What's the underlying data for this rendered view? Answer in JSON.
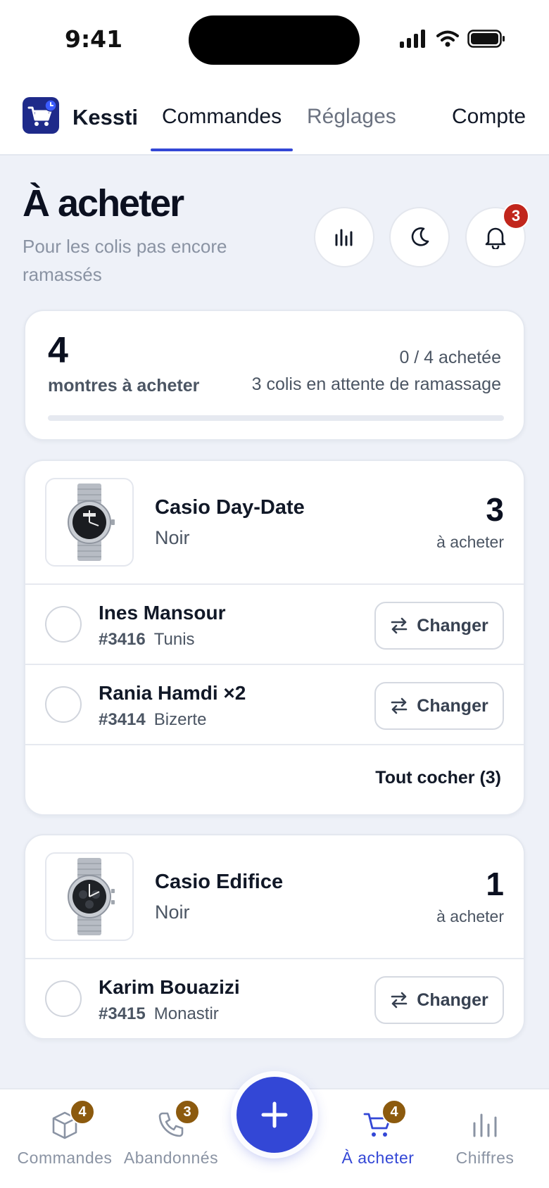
{
  "status_bar": {
    "time": "9:41"
  },
  "nav": {
    "brand": "Kessti",
    "tabs": [
      "Commandes",
      "Réglages"
    ],
    "account": "Compte",
    "active_tab": "Commandes"
  },
  "header": {
    "title": "À acheter",
    "subtitle": "Pour les colis pas encore ramassés",
    "notification_count": "3"
  },
  "summary": {
    "count": "4",
    "count_label": "montres à acheter",
    "bought": "0 / 4 achetée",
    "pending": "3 colis en attente de ramassage",
    "progress": 0
  },
  "products": [
    {
      "name": "Casio Day-Date",
      "variant": "Noir",
      "qty": "3",
      "qty_label": "à acheter",
      "orders": [
        {
          "customer": "Ines Mansour",
          "number": "#3416",
          "city": "Tunis",
          "change": "Changer"
        },
        {
          "customer": "Rania Hamdi ×2",
          "number": "#3414",
          "city": "Bizerte",
          "change": "Changer"
        }
      ],
      "check_all": "Tout cocher (3)"
    },
    {
      "name": "Casio Edifice",
      "variant": "Noir",
      "qty": "1",
      "qty_label": "à acheter",
      "orders": [
        {
          "customer": "Karim Bouazizi",
          "number": "#3415",
          "city": "Monastir",
          "change": "Changer"
        }
      ]
    }
  ],
  "bottom_nav": {
    "items": [
      {
        "label": "Commandes",
        "badge": "4"
      },
      {
        "label": "Abandonnés",
        "badge": "3"
      },
      {
        "label": "À acheter",
        "badge": "4"
      },
      {
        "label": "Chiffres"
      }
    ],
    "active": "À acheter"
  },
  "colors": {
    "accent": "#3347D6",
    "badge_red": "#C1261C",
    "badge_brown": "#8C5A0E"
  }
}
